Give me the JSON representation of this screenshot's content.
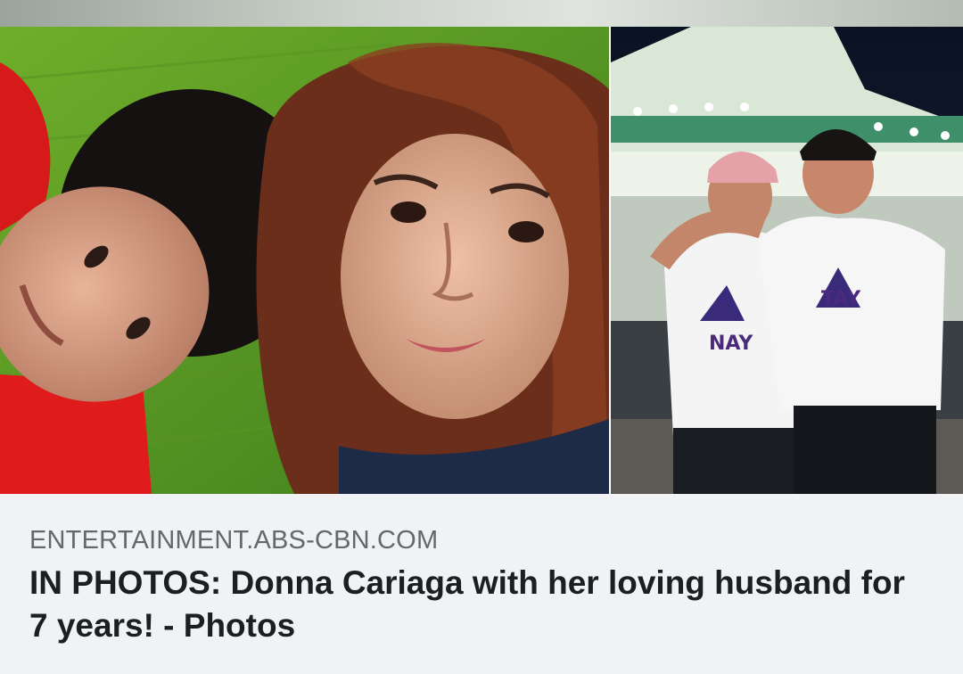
{
  "link_preview": {
    "images": [
      {
        "name": "couple-selfie-photo"
      },
      {
        "name": "couple-standing-photo",
        "shirt_texts": [
          "NAY",
          "TAY"
        ]
      }
    ],
    "domain": "ENTERTAINMENT.ABS-CBN.COM",
    "headline": "IN PHOTOS: Donna Cariaga with her loving husband for 7 years! - Photos"
  },
  "colors": {
    "background": "#f0f2f5",
    "domain_text": "#65676b",
    "headline_text": "#1c1e21"
  }
}
